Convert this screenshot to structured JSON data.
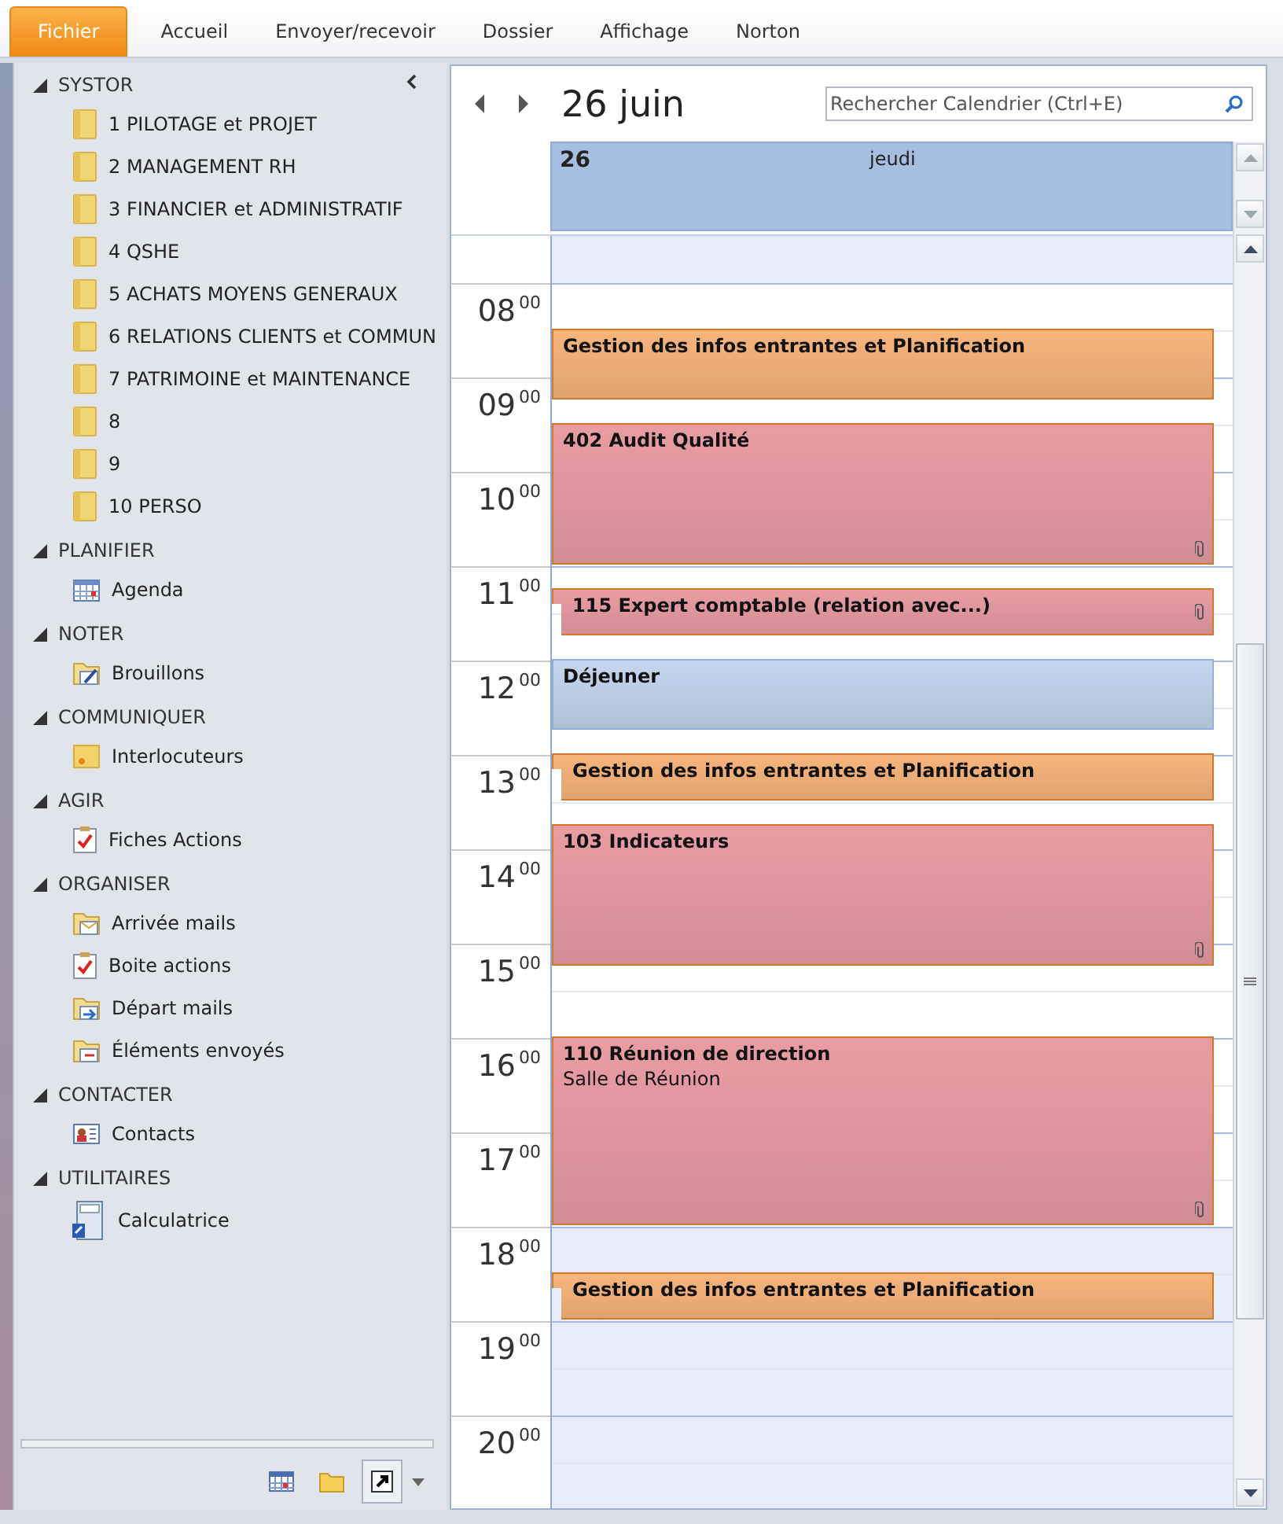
{
  "ribbon_tabs": [
    {
      "label": "Fichier",
      "kind": "file"
    },
    {
      "label": "Accueil",
      "kind": "tab"
    },
    {
      "label": "Envoyer/recevoir",
      "kind": "tab"
    },
    {
      "label": "Dossier",
      "kind": "tab"
    },
    {
      "label": "Affichage",
      "kind": "tab"
    },
    {
      "label": "Norton",
      "kind": "tab"
    }
  ],
  "sidebar": {
    "sections": [
      {
        "title": "SYSTOR",
        "expanded": true,
        "items": [
          {
            "label": "1 PILOTAGE et PROJET",
            "kind": "folder"
          },
          {
            "label": "2 MANAGEMENT RH",
            "kind": "folder"
          },
          {
            "label": "3 FINANCIER et ADMINISTRATIF",
            "kind": "folder"
          },
          {
            "label": "4 QSHE",
            "kind": "folder"
          },
          {
            "label": "5 ACHATS MOYENS GENERAUX",
            "kind": "folder"
          },
          {
            "label": "6 RELATIONS CLIENTS et COMMUN",
            "kind": "folder"
          },
          {
            "label": "7 PATRIMOINE et MAINTENANCE",
            "kind": "folder"
          },
          {
            "label": "8",
            "kind": "folder"
          },
          {
            "label": "9",
            "kind": "folder"
          },
          {
            "label": "10 PERSO",
            "kind": "folder"
          }
        ]
      },
      {
        "title": "PLANIFIER",
        "expanded": true,
        "items": [
          {
            "label": "Agenda",
            "kind": "calendar"
          }
        ]
      },
      {
        "title": "NOTER",
        "expanded": true,
        "items": [
          {
            "label": "Brouillons",
            "kind": "drafts"
          }
        ]
      },
      {
        "title": "COMMUNIQUER",
        "expanded": true,
        "items": [
          {
            "label": "Interlocuteurs",
            "kind": "note"
          }
        ]
      },
      {
        "title": "AGIR",
        "expanded": true,
        "items": [
          {
            "label": "Fiches Actions",
            "kind": "task"
          }
        ]
      },
      {
        "title": "ORGANISER",
        "expanded": true,
        "items": [
          {
            "label": "Arrivée mails",
            "kind": "inbox"
          },
          {
            "label": "Boite actions",
            "kind": "task"
          },
          {
            "label": "Départ mails",
            "kind": "outbox"
          },
          {
            "label": "Éléments envoyés",
            "kind": "sent"
          }
        ]
      },
      {
        "title": "CONTACTER",
        "expanded": true,
        "items": [
          {
            "label": "Contacts",
            "kind": "contact"
          }
        ]
      },
      {
        "title": "UTILITAIRES",
        "expanded": true,
        "items": [
          {
            "label": "Calculatrice",
            "kind": "calculator"
          }
        ]
      }
    ]
  },
  "calendar": {
    "date_title": "26 juin",
    "search": {
      "placeholder": "Rechercher Calendrier (Ctrl+E)"
    },
    "day": {
      "number": "26",
      "weekday": "jeudi"
    },
    "hours": [
      {
        "label": "08$^{00}$",
        "working": true
      },
      {
        "label": "09$^{00}$",
        "working": true
      },
      {
        "label": "10$^{00}$",
        "working": true
      },
      {
        "label": "11$^{00}$",
        "working": true
      },
      {
        "label": "12$^{00}$",
        "working": true
      },
      {
        "label": "13$^{00}$",
        "working": true
      },
      {
        "label": "14$^{00}$",
        "working": true
      },
      {
        "label": "15$^{00}$",
        "working": true
      },
      {
        "label": "16$^{00}$",
        "working": true
      },
      {
        "label": "17$^{00}$",
        "working": true
      },
      {
        "label": "18$^{00}$",
        "working": false
      },
      {
        "label": "19$^{00}$",
        "working": false
      },
      {
        "label": "20$^{00}$",
        "working": false
      }
    ],
    "events": [
      {
        "title": "Gestion des infos entrantes et Planification",
        "color": "#f8b57c",
        "notched": false,
        "attachment": false
      },
      {
        "title": "402 Audit Qualité",
        "color": "#e99da3",
        "notched": false,
        "attachment": true
      },
      {
        "title": "115 Expert comptable (relation avec...)",
        "color": "#e99da3",
        "notched": true,
        "attachment": true
      },
      {
        "title": "Déjeuner",
        "color": "#c4d6ee",
        "notched": false,
        "attachment": false
      },
      {
        "title": "Gestion des infos entrantes et Planification",
        "color": "#f8b57c",
        "notched": true,
        "attachment": false
      },
      {
        "title": "103 Indicateurs",
        "color": "#e99da3",
        "notched": false,
        "attachment": true
      },
      {
        "title": "110 Réunion de direction",
        "location": "Salle de Réunion",
        "color": "#e99da3",
        "notched": false,
        "attachment": true
      },
      {
        "title": "Gestion des infos entrantes et Planification",
        "color": "#f8b57c",
        "notched": true,
        "attachment": false
      }
    ]
  },
  "bottom_bar": {
    "buttons": [
      {
        "kind": "calendar",
        "selected": false
      },
      {
        "kind": "folder",
        "selected": false
      },
      {
        "kind": "shortcut",
        "selected": true
      }
    ]
  }
}
